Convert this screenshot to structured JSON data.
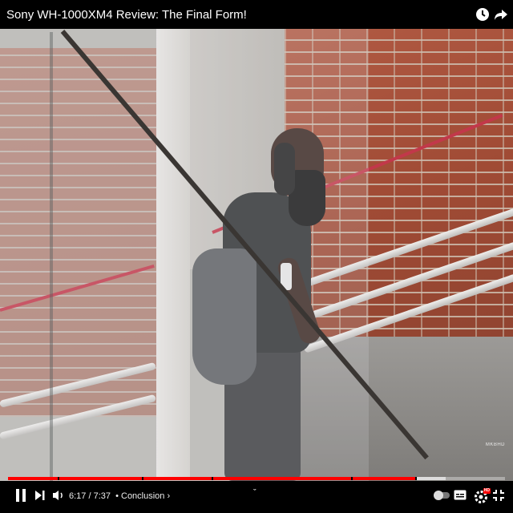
{
  "video": {
    "title": "Sony WH-1000XM4 Review: The Final Form!",
    "watermark": "MKBHD",
    "progress_fraction": 0.82,
    "buffer_fraction": 0.88,
    "chapter_markers": [
      0.1,
      0.27,
      0.41,
      0.69,
      0.82
    ]
  },
  "player": {
    "current_time": "6:17",
    "separator": " / ",
    "duration": "7:37",
    "chapter_prefix": "• ",
    "chapter": "Conclusion",
    "chapter_arrow": " ›",
    "up_chevron": "ˇ",
    "hd_badge": "HD"
  },
  "icons": [
    "clock-icon",
    "share-icon",
    "pause-icon",
    "next-icon",
    "volume-icon",
    "autoplay-toggle-icon",
    "subtitles-icon",
    "settings-icon",
    "fullscreen-exit-icon"
  ],
  "colors": {
    "accent": "#ff0000",
    "bar": "#000000",
    "text": "#ffffff"
  }
}
